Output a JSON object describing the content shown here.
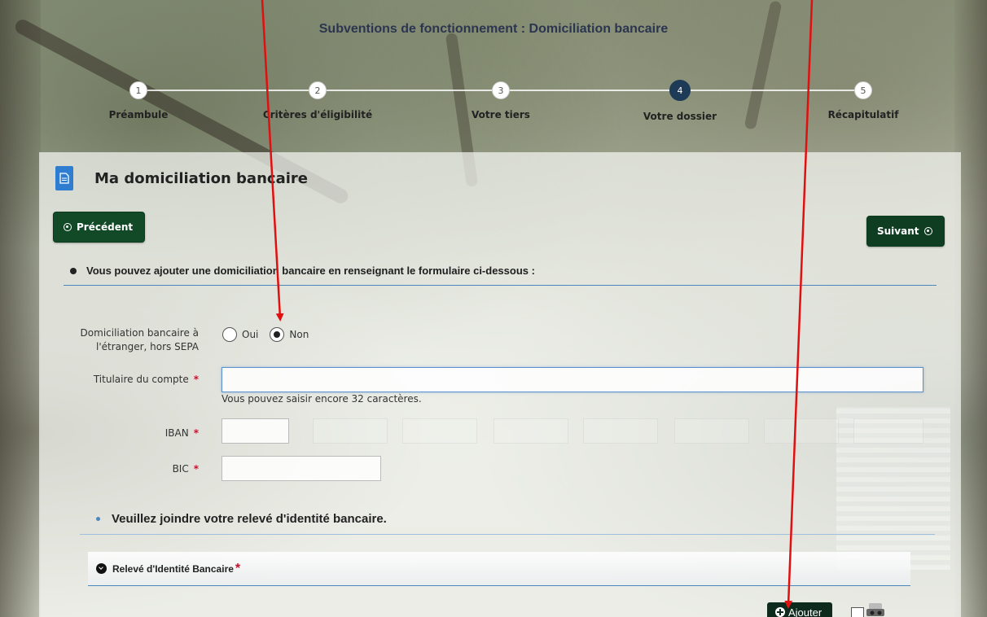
{
  "page_title": "Subventions de fonctionnement : Domiciliation bancaire",
  "steps": [
    {
      "number": "1",
      "label": "Préambule"
    },
    {
      "number": "2",
      "label": "Critères d'éligibilité"
    },
    {
      "number": "3",
      "label": "Votre tiers"
    },
    {
      "number": "4",
      "label": "Votre dossier"
    },
    {
      "number": "5",
      "label": "Récapitulatif"
    }
  ],
  "active_step": 4,
  "panel": {
    "title": "Ma domiciliation bancaire",
    "prev_label": "Précédent",
    "next_label": "Suivant",
    "intro": "Vous pouvez ajouter une domiciliation bancaire en renseignant le formulaire ci-dessous :"
  },
  "form": {
    "foreign_label_line1": "Domiciliation bancaire à",
    "foreign_label_line2": "l'étranger, hors SEPA",
    "radio_yes": "Oui",
    "radio_no": "Non",
    "radio_selected": "Non",
    "holder_label": "Titulaire du compte",
    "holder_value": "",
    "holder_helper": "Vous pouvez saisir encore 32 caractères.",
    "iban_label": "IBAN",
    "bic_label": "BIC",
    "required_mark": "*"
  },
  "rib": {
    "instruction": "Veuillez joindre votre relevé d'identité bancaire.",
    "accordion_label": "Relevé d'Identité Bancaire",
    "add_label": "Ajouter"
  },
  "colors": {
    "accent_blue": "#2e7dd1",
    "button_green": "#124a28",
    "active_step": "#1d3b57",
    "required_red": "#c8102e",
    "annotation_arrow": "#e01010"
  }
}
